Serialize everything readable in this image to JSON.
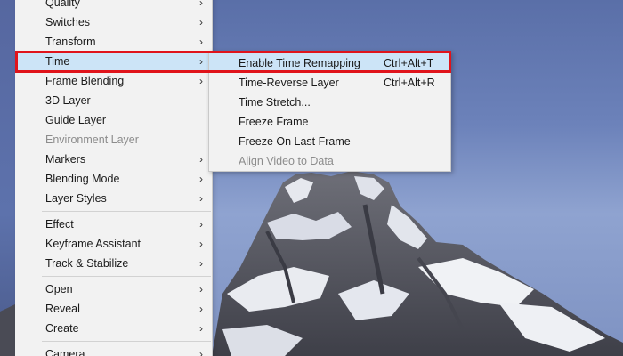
{
  "main_menu": {
    "items": [
      {
        "label": "Quality",
        "submenu": true,
        "disabled": false
      },
      {
        "label": "Switches",
        "submenu": true,
        "disabled": false
      },
      {
        "label": "Transform",
        "submenu": true,
        "disabled": false
      },
      {
        "label": "Time",
        "submenu": true,
        "disabled": false,
        "highlighted": true
      },
      {
        "label": "Frame Blending",
        "submenu": true,
        "disabled": false
      },
      {
        "label": "3D Layer",
        "submenu": false,
        "disabled": false
      },
      {
        "label": "Guide Layer",
        "submenu": false,
        "disabled": false
      },
      {
        "label": "Environment Layer",
        "submenu": false,
        "disabled": true
      },
      {
        "label": "Markers",
        "submenu": true,
        "disabled": false
      },
      {
        "label": "Blending Mode",
        "submenu": true,
        "disabled": false
      },
      {
        "label": "Layer Styles",
        "submenu": true,
        "disabled": false
      },
      {
        "label": "Effect",
        "submenu": true,
        "disabled": false
      },
      {
        "label": "Keyframe Assistant",
        "submenu": true,
        "disabled": false
      },
      {
        "label": "Track & Stabilize",
        "submenu": true,
        "disabled": false
      },
      {
        "label": "Open",
        "submenu": true,
        "disabled": false
      },
      {
        "label": "Reveal",
        "submenu": true,
        "disabled": false
      },
      {
        "label": "Create",
        "submenu": true,
        "disabled": false
      },
      {
        "label": "Camera",
        "submenu": true,
        "disabled": false
      }
    ],
    "arrow_glyph": "›"
  },
  "time_submenu": {
    "items": [
      {
        "label": "Enable Time Remapping",
        "shortcut": "Ctrl+Alt+T",
        "disabled": false,
        "highlighted": true
      },
      {
        "label": "Time-Reverse Layer",
        "shortcut": "Ctrl+Alt+R",
        "disabled": false
      },
      {
        "label": "Time Stretch...",
        "shortcut": "",
        "disabled": false
      },
      {
        "label": "Freeze Frame",
        "shortcut": "",
        "disabled": false
      },
      {
        "label": "Freeze On Last Frame",
        "shortcut": "",
        "disabled": false
      },
      {
        "label": "Align Video to Data",
        "shortcut": "",
        "disabled": true
      }
    ]
  },
  "colors": {
    "menu_bg": "#f2f2f2",
    "highlight": "#cce4f7",
    "disabled_text": "#8c8c8c",
    "annotation_red": "#e0141b"
  }
}
